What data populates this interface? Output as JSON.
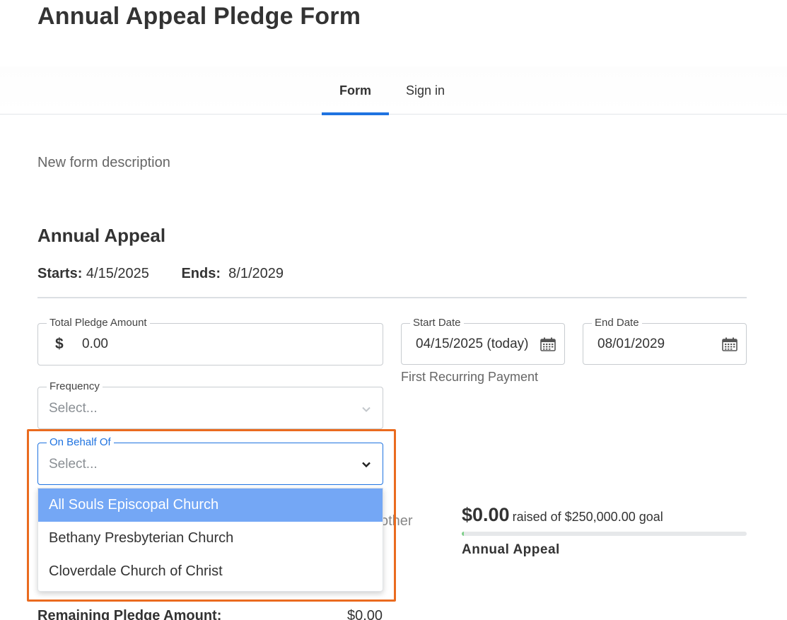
{
  "page": {
    "title": "Annual Appeal Pledge Form",
    "description": "New form description"
  },
  "tabs": [
    {
      "label": "Form",
      "active": true
    },
    {
      "label": "Sign in",
      "active": false
    }
  ],
  "campaign": {
    "title": "Annual Appeal",
    "starts_label": "Starts:",
    "starts_value": "4/15/2025",
    "ends_label": "Ends:",
    "ends_value": "8/1/2029"
  },
  "fields": {
    "total_pledge": {
      "label": "Total Pledge Amount",
      "currency_symbol": "$",
      "value": "0.00"
    },
    "start_date": {
      "label": "Start Date",
      "value": "04/15/2025 (today)",
      "helper": "First Recurring Payment"
    },
    "end_date": {
      "label": "End Date",
      "value": "08/01/2029"
    },
    "frequency": {
      "label": "Frequency",
      "placeholder": "Select..."
    },
    "on_behalf_of": {
      "label": "On Behalf Of",
      "placeholder": "Select..."
    }
  },
  "dropdown": {
    "options": [
      "All Souls Episcopal Church",
      "Bethany Presbyterian Church",
      "Cloverdale Church of Christ"
    ],
    "selected_index": 0
  },
  "partially_hidden_text": "other",
  "progress": {
    "raised_amount": "$0.00",
    "raised_text": "raised of $250,000.00 goal",
    "caption": "Annual Appeal",
    "fraction": 0.0
  },
  "remaining": {
    "label": "Remaining Pledge Amount:",
    "value": "$0.00"
  },
  "colors": {
    "accent": "#1f73e0",
    "selected_option": "#74a7f5",
    "highlight": "#ea6b1f",
    "progress_fill": "#7fd08a"
  },
  "icons": {
    "calendar": "calendar-icon",
    "chevron": "chevron-down-icon",
    "currency": "dollar-sign"
  }
}
